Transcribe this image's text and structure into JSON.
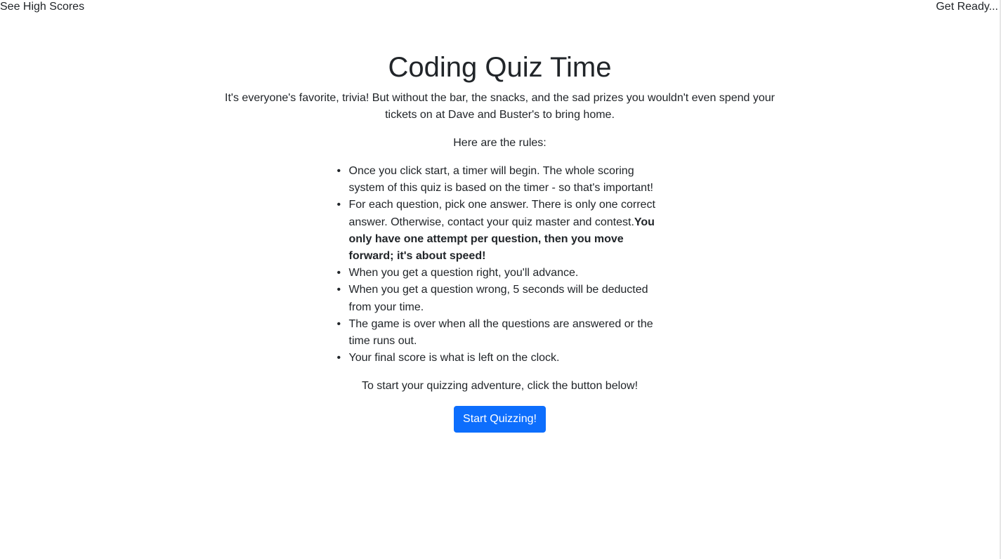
{
  "header": {
    "high_scores_link": "See High Scores",
    "timer_text": "Get Ready..."
  },
  "main": {
    "title": "Coding Quiz Time",
    "intro": "It's everyone's favorite, trivia! But without the bar, the snacks, and the sad prizes you wouldn't even spend your tickets on at Dave and Buster's to bring home.",
    "rules_heading": "Here are the rules:",
    "rules": [
      {
        "text": "Once you click start, a timer will begin. The whole scoring system of this quiz is based on the timer - so that's important!",
        "bold": ""
      },
      {
        "text": "For each question, pick one answer. There is only one correct answer. Otherwise, contact your quiz master and contest.",
        "bold": "You only have one attempt per question, then you move forward; it's about speed!"
      },
      {
        "text": "When you get a question right, you'll advance.",
        "bold": ""
      },
      {
        "text": "When you get a question wrong, 5 seconds will be deducted from your time.",
        "bold": ""
      },
      {
        "text": "The game is over when all the questions are answered or the time runs out.",
        "bold": ""
      },
      {
        "text": "Your final score is what is left on the clock.",
        "bold": ""
      }
    ],
    "cta_text": "To start your quizzing adventure, click the button below!",
    "start_button_label": "Start Quizzing!"
  },
  "colors": {
    "primary_button": "#0d6efd",
    "text": "#212529",
    "background": "#ffffff"
  }
}
